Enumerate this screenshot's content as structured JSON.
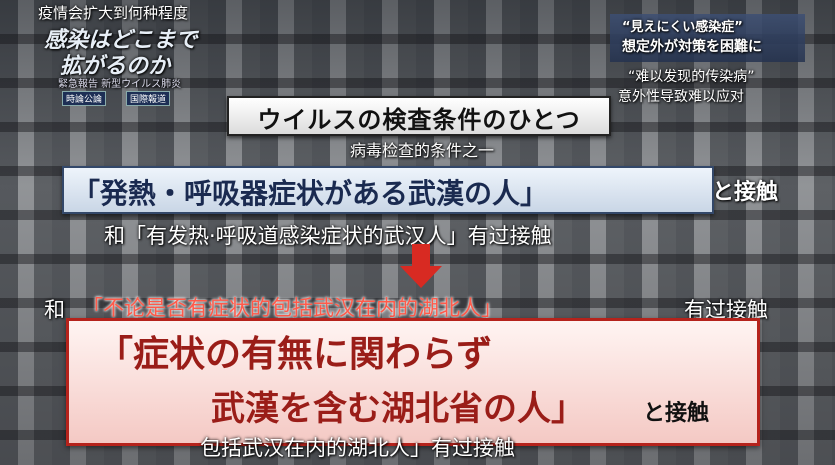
{
  "top_left": {
    "cn_title": "疫情会扩大到何种程度",
    "jp_line1": "感染はどこまで",
    "jp_line2": "拡がるのか",
    "small_line": "緊急報告 新型ウイルス肺炎",
    "badge1": "時論公論",
    "badge2": "国際報道"
  },
  "top_right": {
    "jp_line1": "“見えにくい感染症”",
    "jp_line2": "想定外が対策を困難に",
    "cn_line1": "“难以发现的传染病”",
    "cn_line2": "意外性导致难以应对"
  },
  "headline": {
    "jp": "ウイルスの検査条件のひとつ",
    "cn": "病毒检查的条件之一"
  },
  "condition_before": {
    "jp": "「発熱・呼吸器症状がある武漢の人」",
    "jp_tail": "と接触",
    "cn": "和「有发热·呼吸道感染症状的武汉人」有过接触"
  },
  "condition_after": {
    "cn_prefix": "和",
    "cn_red": "「不论是否有症状的包括武汉在内的湖北人」",
    "cn_tail": "有过接触",
    "jp_line1": "「症状の有無に関わらず",
    "jp_line2": "武漢を含む湖北省の人」",
    "jp_tail": "と接触",
    "cn_bottom": "包括武汉在内的湖北人」有过接触"
  },
  "colors": {
    "arrow": "#d82a22",
    "red_frame": "#b5231c",
    "blue_frame": "#33486a"
  }
}
